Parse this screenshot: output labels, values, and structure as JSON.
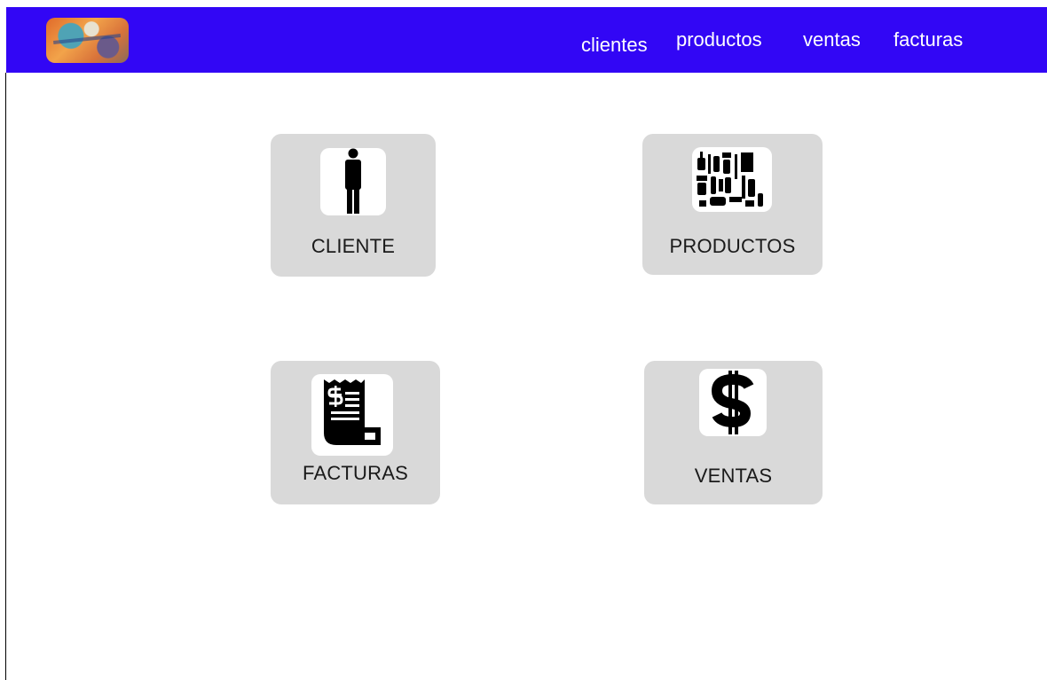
{
  "colors": {
    "navbar": "#3206f5",
    "card": "#d9d9d9",
    "icon_background": "#ffffff",
    "icon_foreground": "#000000",
    "nav_text": "#ffffff"
  },
  "navbar": {
    "logo_icon": "logo-image",
    "links": [
      {
        "label": "clientes"
      },
      {
        "label": "productos"
      },
      {
        "label": "ventas"
      },
      {
        "label": "facturas"
      }
    ]
  },
  "cards": [
    {
      "label": "CLIENTE",
      "icon": "person-icon"
    },
    {
      "label": "PRODUCTOS",
      "icon": "cleaning-products-icon"
    },
    {
      "label": "FACTURAS",
      "icon": "receipt-icon"
    },
    {
      "label": "VENTAS",
      "icon": "dollar-icon"
    }
  ]
}
